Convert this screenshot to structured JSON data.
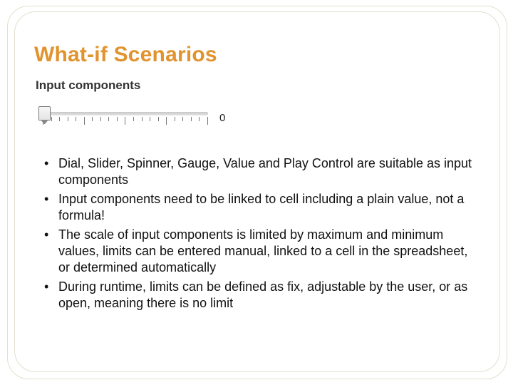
{
  "title": "What-if Scenarios",
  "subtitle": "Input components",
  "slider": {
    "value": "0"
  },
  "bullets": [
    "Dial, Slider, Spinner, Gauge, Value and Play Control are suitable as input components",
    "Input components need to be linked to cell including a plain value, not a formula!",
    "The scale of input components is limited by maximum and minimum values, limits can be entered manual, linked to a cell in the spreadsheet, or determined automatically",
    "During runtime, limits can be defined as fix, adjustable by the user, or as open, meaning there is no limit"
  ]
}
